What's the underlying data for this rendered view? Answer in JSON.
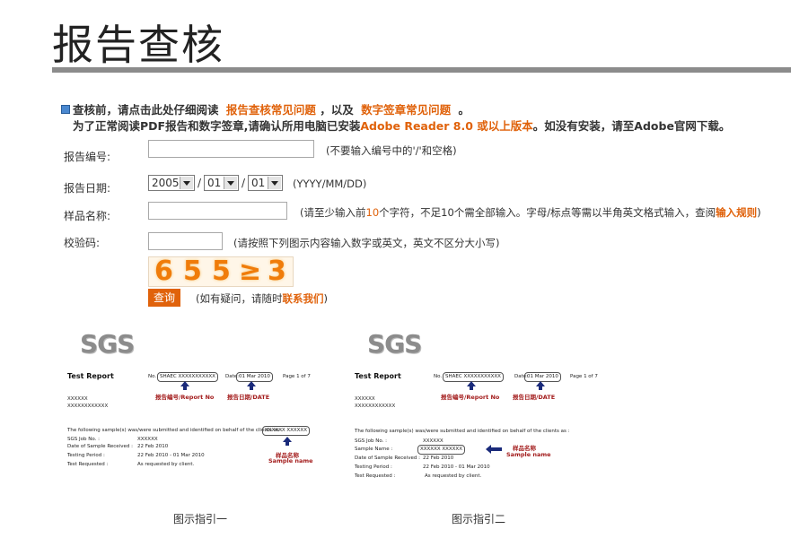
{
  "page": {
    "title": "报告查核"
  },
  "intro": {
    "line1_prefix": "查核前，请点击此处仔细阅读",
    "faq_link": "报告查核常见问题",
    "line1_mid": "，以及",
    "sig_link": "数字签章常见问题",
    "line1_suffix": "。",
    "line2_prefix": "为了正常阅读PDF报告和数字签章,请确认所用电脑已安装",
    "adobe_link": "Adobe Reader 8.0 或以上版本",
    "line2_suffix": "。如没有安装，请至Adobe官网下载。"
  },
  "form": {
    "report_no": {
      "label": "报告编号:",
      "value": "",
      "hint": "(不要输入编号中的'/'和空格)"
    },
    "report_date": {
      "label": "报告日期:",
      "year": "2005",
      "month": "01",
      "day": "01",
      "sep": "/",
      "hint": "(YYYY/MM/DD)"
    },
    "sample_name": {
      "label": "样品名称:",
      "value": "",
      "hint_prefix": "(请至少输入前",
      "hint_num": "10",
      "hint_mid": "个字符，不足10个需全部输入。字母/标点等需以半角英文格式输入，查阅",
      "hint_link": "输入规则",
      "hint_suffix": ")"
    },
    "verify_code": {
      "label": "校验码:",
      "value": "",
      "hint": "(请按照下列图示内容输入数字或英文，英文不区分大小写)",
      "captcha_chars": [
        "6",
        "5",
        "5",
        "≥",
        "3"
      ]
    },
    "query_button": "查询",
    "contact_prefix": "(如有疑问，请随时",
    "contact_link": "联系我们",
    "contact_suffix": ")"
  },
  "samples": [
    {
      "caption": "图示指引一",
      "logo": "SGS",
      "test_report": "Test Report",
      "no_label": "No.",
      "no_value": "SHAEC XXXXXXXXXXX",
      "date_label": "Date:",
      "date_value": "01 Mar 2010",
      "page_text": "Page 1 of 7",
      "report_no_cn": "报告编号/Report No",
      "date_cn": "报告日期/DATE",
      "addr1": "XXXXXX",
      "addr2": "XXXXXXXXXXXX",
      "following": "The following sample(s) was/were submitted and identified on behalf of the clients as :",
      "sample_value": "XXXXXX XXXXXX",
      "sample_name_cn": "样品名称",
      "sample_name_en": "Sample name",
      "rows": [
        {
          "k": "SGS Job No. :",
          "v": "XXXXXX"
        },
        {
          "k": "Date of Sample Received :",
          "v": "22 Feb 2010"
        },
        {
          "k": "Testing Period :",
          "v": "22 Feb 2010 - 01 Mar 2010"
        },
        {
          "k": "Test Requested :",
          "v": "As requested by client."
        }
      ]
    },
    {
      "caption": "图示指引二",
      "logo": "SGS",
      "test_report": "Test Report",
      "no_label": "No.",
      "no_value": "SHAEC XXXXXXXXXXX",
      "date_label": "Date:",
      "date_value": "01 Mar 2010",
      "page_text": "Page 1 of 7",
      "report_no_cn": "报告编号/Report No",
      "date_cn": "报告日期/DATE",
      "addr1": "XXXXXX",
      "addr2": "XXXXXXXXXXXX",
      "following": "The following sample(s) was/were submitted and identified on behalf of the clients as :",
      "sample_value": "XXXXXX XXXXXX",
      "sample_name_cn": "样品名称",
      "sample_name_en": "Sample name",
      "rows": [
        {
          "k": "SGS Job No. :",
          "v": "XXXXXX"
        },
        {
          "k": "Sample Name :",
          "v": ""
        },
        {
          "k": "Date of Sample Received :",
          "v": "22 Feb 2010"
        },
        {
          "k": "Testing Period :",
          "v": "22 Feb 2010 - 01 Mar 2010"
        },
        {
          "k": "Test Requested :",
          "v": "As requested by client."
        }
      ]
    }
  ]
}
